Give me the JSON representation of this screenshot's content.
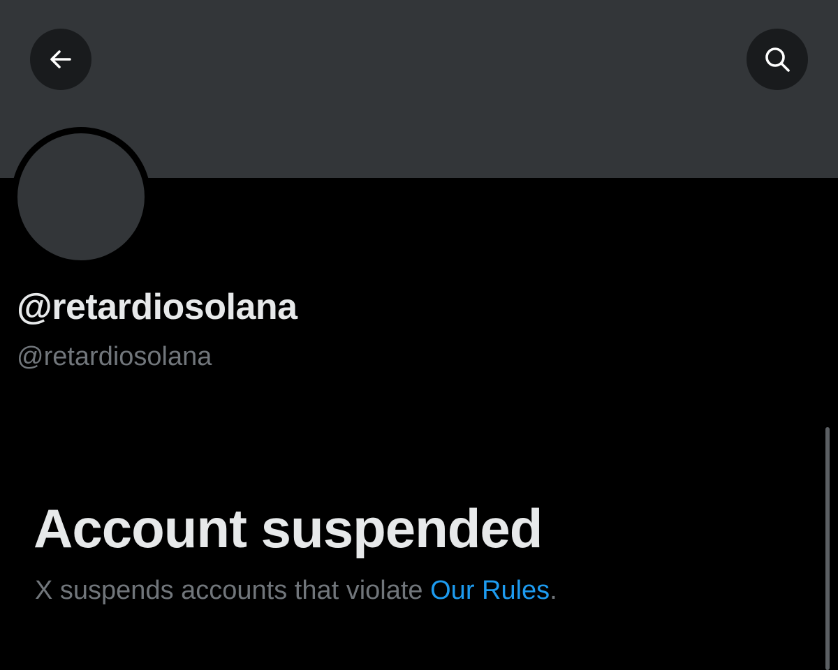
{
  "header": {
    "back_icon": "arrow-left-icon",
    "search_icon": "search-icon"
  },
  "profile": {
    "display_name": "@retardiosolana",
    "handle": "@retardiosolana"
  },
  "notice": {
    "title": "Account suspended",
    "message_prefix": "X suspends accounts that violate ",
    "rules_link": "Our Rules",
    "message_suffix": "."
  },
  "colors": {
    "background": "#000000",
    "banner": "#333639",
    "link": "#1d9bf0",
    "muted_text": "#71767b",
    "primary_text": "#e7e9ea"
  }
}
